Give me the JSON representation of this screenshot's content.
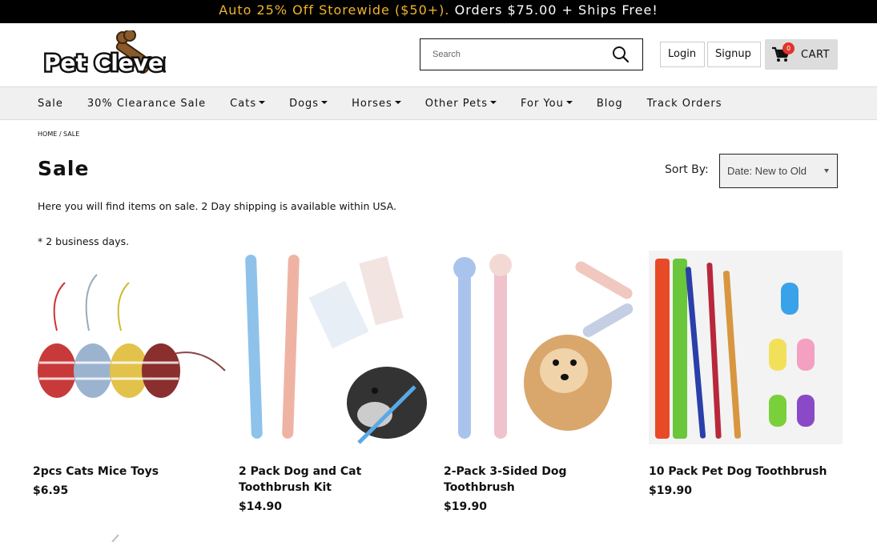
{
  "promo": {
    "accent": "Auto 25% Off Storewide ($50+).",
    "rest": "Orders $75.00 + Ships Free!"
  },
  "brand": {
    "logo_text": "Pet Clever"
  },
  "search": {
    "placeholder": "Search"
  },
  "header": {
    "login": "Login",
    "signup": "Signup",
    "cart_label": "CART",
    "cart_count": "0"
  },
  "nav": [
    {
      "label": "Sale"
    },
    {
      "label": "30% Clearance Sale"
    },
    {
      "label": "Cats"
    },
    {
      "label": "Dogs"
    },
    {
      "label": "Horses"
    },
    {
      "label": "Other Pets"
    },
    {
      "label": "For You"
    },
    {
      "label": "Blog"
    },
    {
      "label": "Track Orders"
    }
  ],
  "breadcrumb": "HOME / SALE",
  "page": {
    "title": "Sale",
    "description": "Here you will find items on sale. 2 Day shipping is available within USA.",
    "note": "* 2 business days."
  },
  "sort": {
    "label": "Sort By:",
    "value": "Date: New to Old"
  },
  "products": [
    {
      "name": "2pcs Cats Mice Toys",
      "price": "$6.95"
    },
    {
      "name": "2 Pack Dog and Cat Toothbrush Kit",
      "price": "$14.90"
    },
    {
      "name": "2-Pack 3-Sided Dog Toothbrush",
      "price": "$19.90"
    },
    {
      "name": "10 Pack Pet Dog Toothbrush",
      "price": "$19.90"
    }
  ],
  "colors": {
    "accent": "#f0b429",
    "badge": "#e0332c",
    "nav_bg": "#f0f0f0"
  }
}
